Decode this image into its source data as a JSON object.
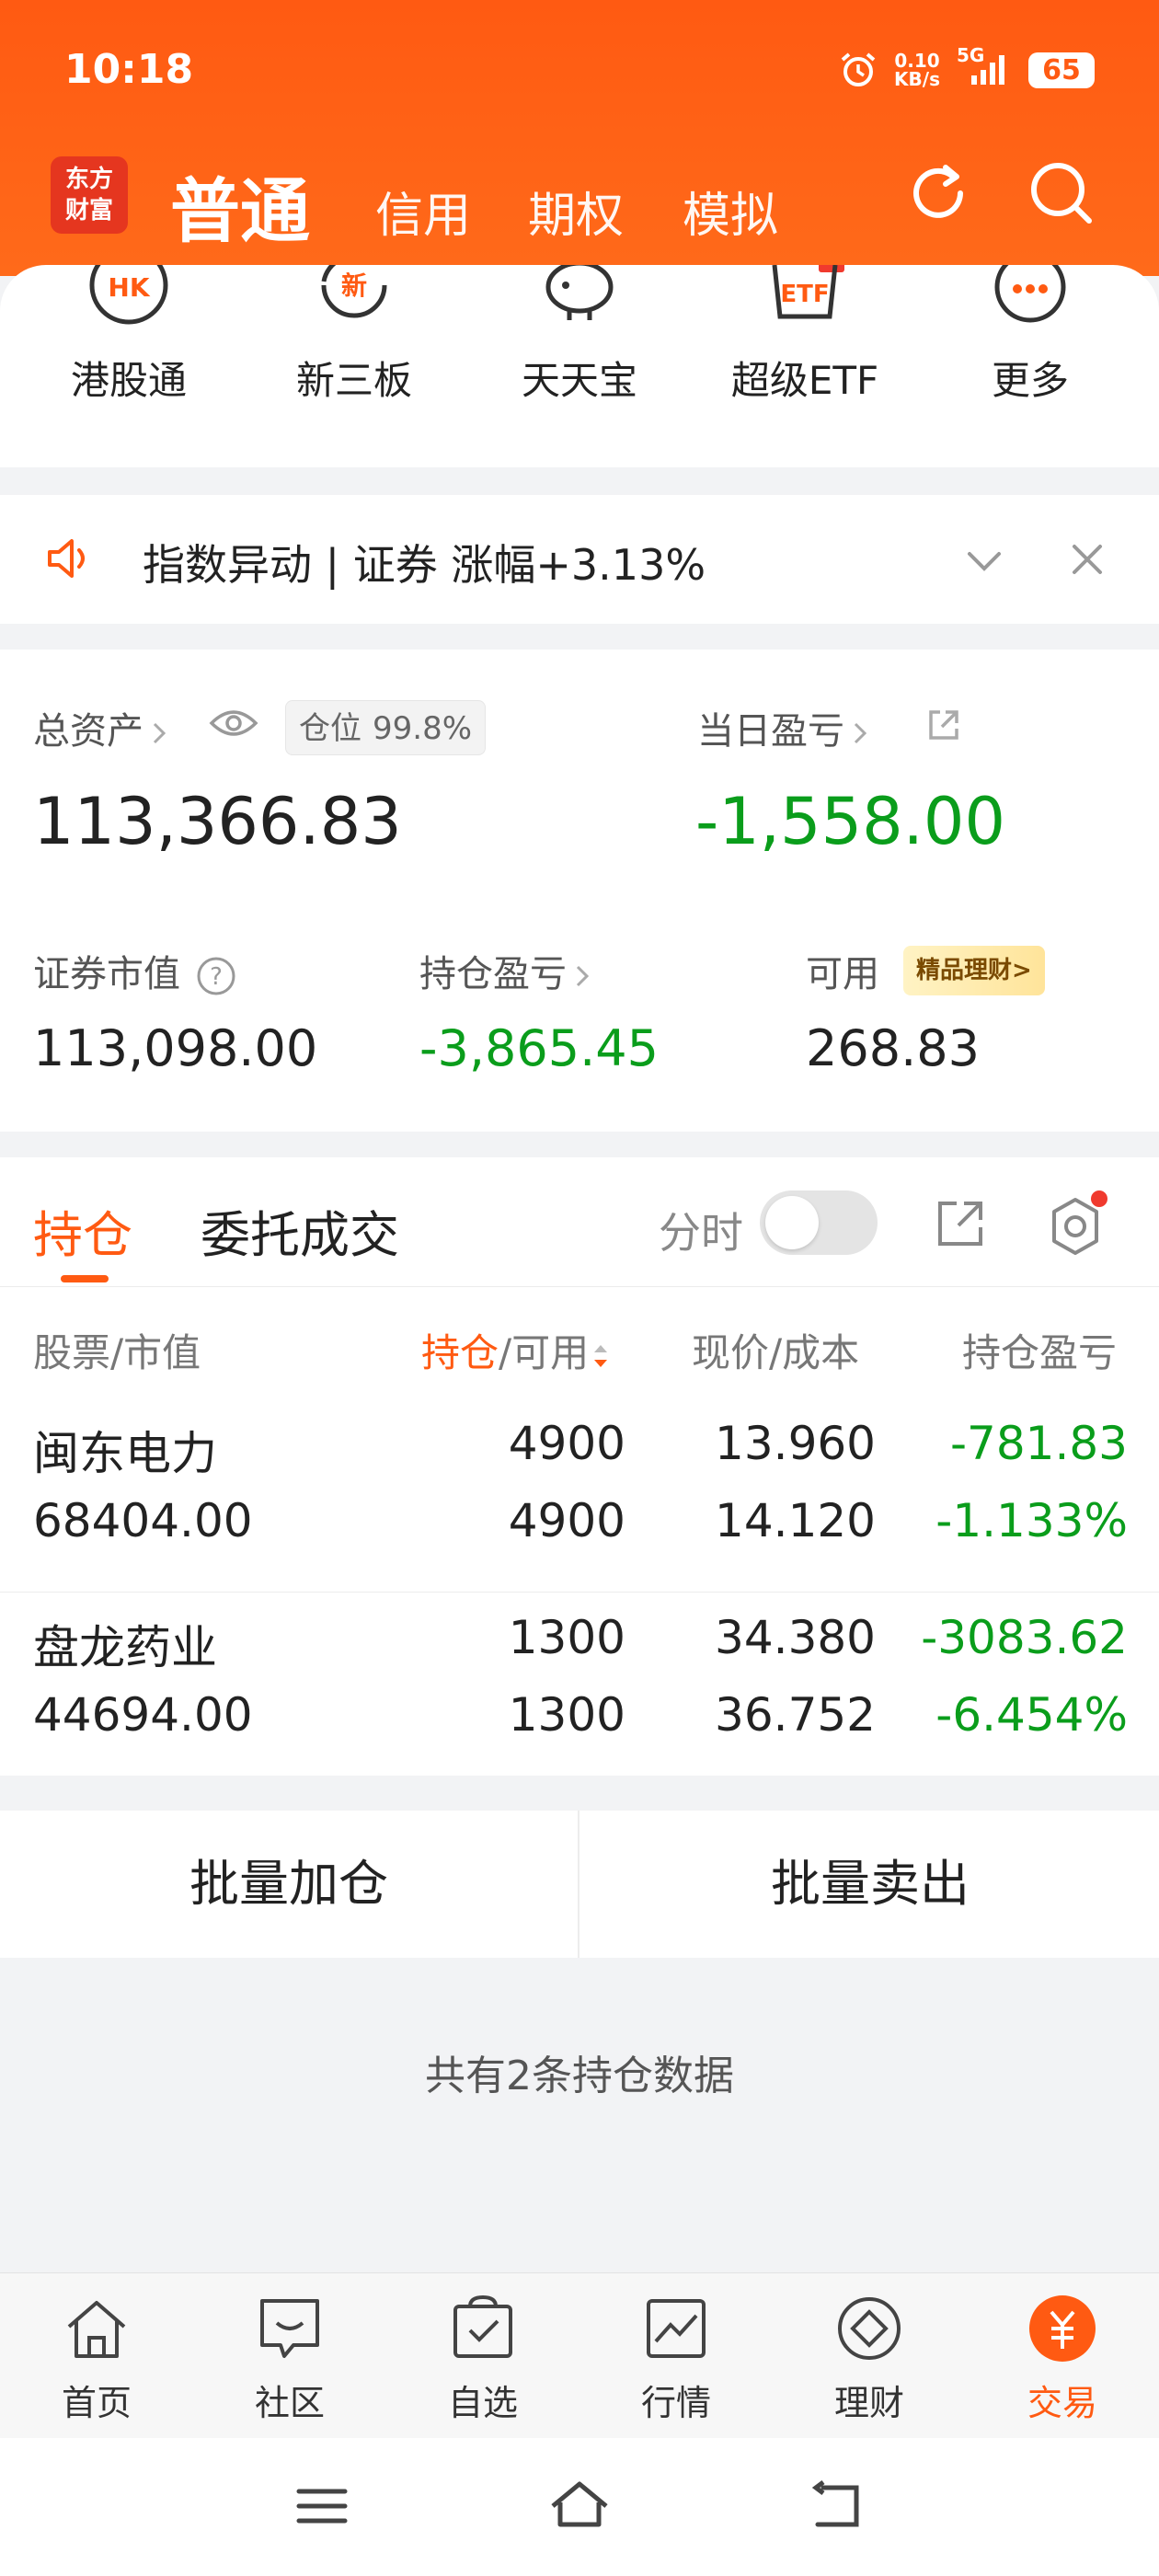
{
  "status_bar": {
    "time": "10:18",
    "net_speed_value": "0.10",
    "net_speed_unit": "KB/s",
    "network": "5G",
    "battery": "65"
  },
  "header": {
    "logo_line1": "东方",
    "logo_line2": "财富",
    "active_tab": "普通",
    "tabs": [
      "信用",
      "期权",
      "模拟"
    ]
  },
  "quick_links": [
    {
      "label": "港股通",
      "icon": "hk-icon"
    },
    {
      "label": "新三板",
      "icon": "new-board-icon"
    },
    {
      "label": "天天宝",
      "icon": "piggy-bank-icon"
    },
    {
      "label": "超级ETF",
      "icon": "etf-icon"
    },
    {
      "label": "更多",
      "icon": "more-icon"
    }
  ],
  "notice": {
    "text": "指数异动 | 证券 涨幅+3.13%"
  },
  "assets": {
    "total_label": "总资产",
    "position_label": "仓位",
    "position_value": "99.8%",
    "total_value": "113,366.83",
    "daily_pl_label": "当日盈亏",
    "daily_pl_value": "-1,558.00",
    "market_value_label": "证券市值",
    "market_value": "113,098.00",
    "holding_pl_label": "持仓盈亏",
    "holding_pl_value": "-3,865.45",
    "available_label": "可用",
    "wealth_badge": "精品理财>",
    "available_value": "268.83"
  },
  "positions": {
    "tab_active": "持仓",
    "tab_other": "委托成交",
    "fenshi_label": "分时",
    "header": {
      "col1": "股票/市值",
      "col2_hl": "持仓",
      "col2_rest": "/可用",
      "col3": "现价/成本",
      "col4": "持仓盈亏"
    },
    "rows": [
      {
        "name": "闽东电力",
        "market_value": "68404.00",
        "holding": "4900",
        "available": "4900",
        "price": "13.960",
        "cost": "14.120",
        "pl": "-781.83",
        "pl_pct": "-1.133%"
      },
      {
        "name": "盘龙药业",
        "market_value": "44694.00",
        "holding": "1300",
        "available": "1300",
        "price": "34.380",
        "cost": "36.752",
        "pl": "-3083.62",
        "pl_pct": "-6.454%"
      }
    ]
  },
  "batch": {
    "add": "批量加仓",
    "sell": "批量卖出"
  },
  "summary": "共有2条持仓数据",
  "bottom_nav": [
    {
      "label": "首页",
      "icon": "home-icon"
    },
    {
      "label": "社区",
      "icon": "community-icon"
    },
    {
      "label": "自选",
      "icon": "watchlist-icon"
    },
    {
      "label": "行情",
      "icon": "market-icon"
    },
    {
      "label": "理财",
      "icon": "wealth-icon"
    },
    {
      "label": "交易",
      "icon": "trade-icon"
    }
  ],
  "colors": {
    "brand": "#ff5a12",
    "loss_green": "#0a9d1b"
  }
}
